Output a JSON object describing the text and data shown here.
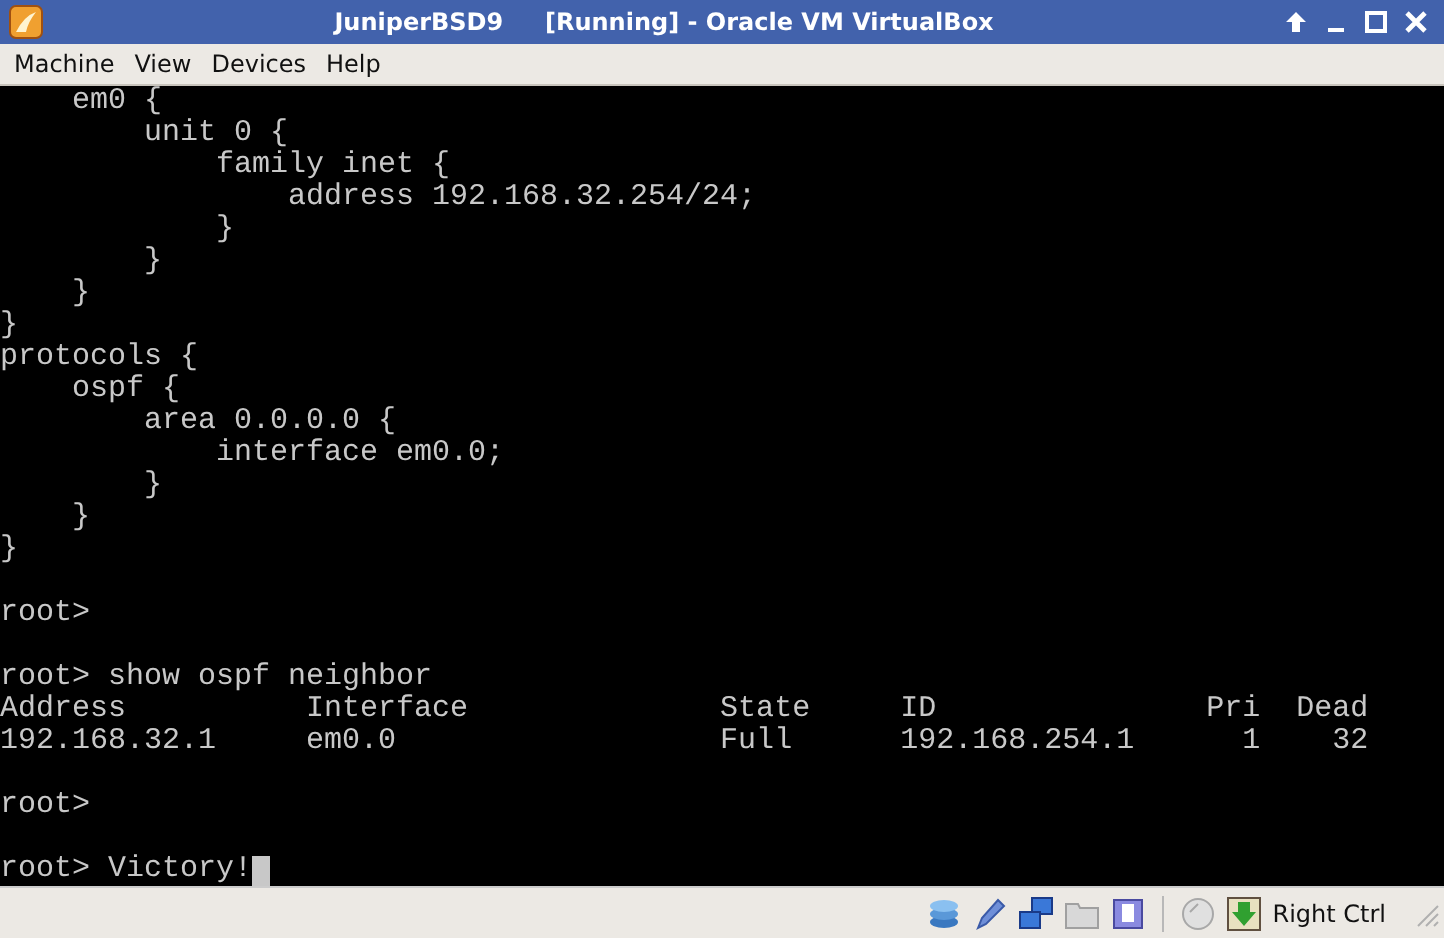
{
  "window": {
    "title": "JuniperBSD9     [Running] - Oracle VM VirtualBox"
  },
  "menu": [
    "Machine",
    "View",
    "Devices",
    "Help"
  ],
  "terminal": {
    "blocks": [
      {
        "lines": [
          {
            "text": "    em0 {"
          },
          {
            "text": "        unit 0 {"
          },
          {
            "text": "            family inet {"
          },
          {
            "text": "                address 192.168.32.254/24;"
          },
          {
            "text": "            }"
          },
          {
            "text": "        }"
          },
          {
            "text": "    }"
          },
          {
            "text": "}"
          },
          {
            "text": "protocols {"
          },
          {
            "text": "    ospf {"
          },
          {
            "text": "        area 0.0.0.0 {"
          },
          {
            "text": "            interface em0.0;"
          },
          {
            "text": "        }"
          },
          {
            "text": "    }"
          },
          {
            "text": "}"
          }
        ]
      },
      {
        "lines": [
          {
            "text": "root>"
          }
        ]
      },
      {
        "lines": [
          {
            "text": "root> show ospf neighbor"
          },
          {
            "text": "Address          Interface              State     ID               Pri  Dead"
          },
          {
            "text": "192.168.32.1     em0.0                  Full      192.168.254.1      1    32"
          }
        ]
      },
      {
        "lines": [
          {
            "text": "root>"
          }
        ]
      },
      {
        "lines": [
          {
            "text": "root> Victory!",
            "cursor": true
          }
        ]
      }
    ]
  },
  "status_bar": {
    "host_key": "Right Ctrl"
  }
}
